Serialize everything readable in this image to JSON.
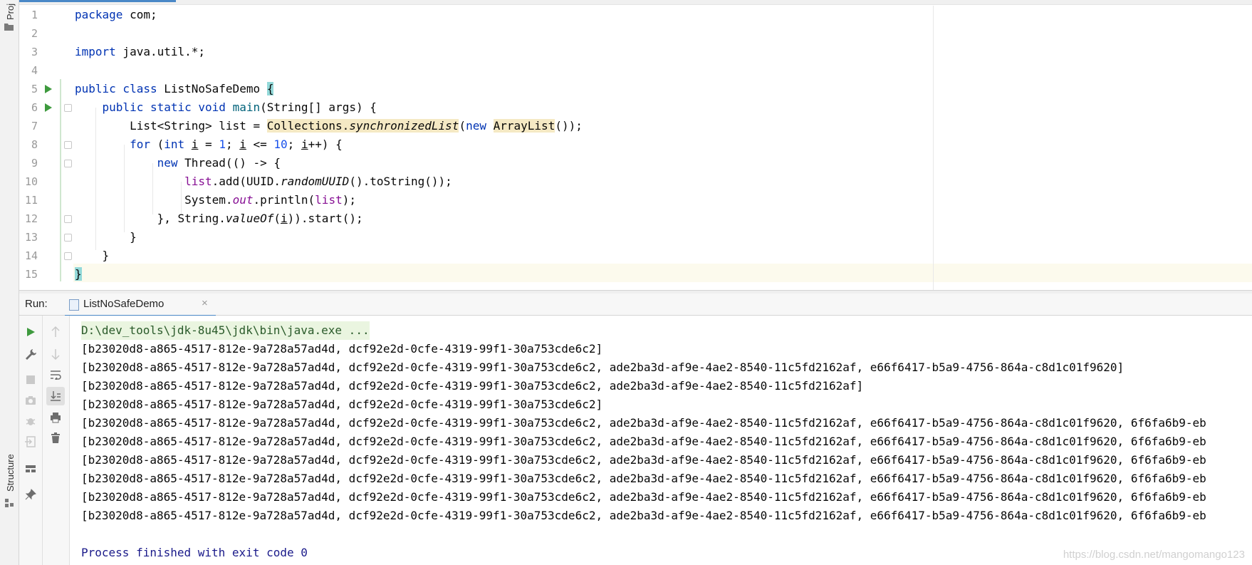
{
  "sidebar": {
    "project_label": "Proj",
    "structure_label": "Structure"
  },
  "editor": {
    "line_numbers": [
      "1",
      "2",
      "3",
      "4",
      "5",
      "6",
      "7",
      "8",
      "9",
      "10",
      "11",
      "12",
      "13",
      "14",
      "15"
    ]
  },
  "run_panel": {
    "run_label": "Run:",
    "tab_label": "ListNoSafeDemo",
    "command": "D:\\dev_tools\\jdk-8u45\\jdk\\bin\\java.exe ...",
    "output_lines": [
      "[b23020d8-a865-4517-812e-9a728a57ad4d, dcf92e2d-0cfe-4319-99f1-30a753cde6c2]",
      "[b23020d8-a865-4517-812e-9a728a57ad4d, dcf92e2d-0cfe-4319-99f1-30a753cde6c2, ade2ba3d-af9e-4ae2-8540-11c5fd2162af, e66f6417-b5a9-4756-864a-c8d1c01f9620]",
      "[b23020d8-a865-4517-812e-9a728a57ad4d, dcf92e2d-0cfe-4319-99f1-30a753cde6c2, ade2ba3d-af9e-4ae2-8540-11c5fd2162af]",
      "[b23020d8-a865-4517-812e-9a728a57ad4d, dcf92e2d-0cfe-4319-99f1-30a753cde6c2]",
      "[b23020d8-a865-4517-812e-9a728a57ad4d, dcf92e2d-0cfe-4319-99f1-30a753cde6c2, ade2ba3d-af9e-4ae2-8540-11c5fd2162af, e66f6417-b5a9-4756-864a-c8d1c01f9620, 6f6fa6b9-eb",
      "[b23020d8-a865-4517-812e-9a728a57ad4d, dcf92e2d-0cfe-4319-99f1-30a753cde6c2, ade2ba3d-af9e-4ae2-8540-11c5fd2162af, e66f6417-b5a9-4756-864a-c8d1c01f9620, 6f6fa6b9-eb",
      "[b23020d8-a865-4517-812e-9a728a57ad4d, dcf92e2d-0cfe-4319-99f1-30a753cde6c2, ade2ba3d-af9e-4ae2-8540-11c5fd2162af, e66f6417-b5a9-4756-864a-c8d1c01f9620, 6f6fa6b9-eb",
      "[b23020d8-a865-4517-812e-9a728a57ad4d, dcf92e2d-0cfe-4319-99f1-30a753cde6c2, ade2ba3d-af9e-4ae2-8540-11c5fd2162af, e66f6417-b5a9-4756-864a-c8d1c01f9620, 6f6fa6b9-eb",
      "[b23020d8-a865-4517-812e-9a728a57ad4d, dcf92e2d-0cfe-4319-99f1-30a753cde6c2, ade2ba3d-af9e-4ae2-8540-11c5fd2162af, e66f6417-b5a9-4756-864a-c8d1c01f9620, 6f6fa6b9-eb",
      "[b23020d8-a865-4517-812e-9a728a57ad4d, dcf92e2d-0cfe-4319-99f1-30a753cde6c2, ade2ba3d-af9e-4ae2-8540-11c5fd2162af, e66f6417-b5a9-4756-864a-c8d1c01f9620, 6f6fa6b9-eb"
    ],
    "finished": "Process finished with exit code 0"
  },
  "watermark": "https://blog.csdn.net/mangomango123",
  "icons": {
    "run": "run-icon",
    "wrench": "wrench-icon",
    "stop": "stop-icon",
    "camera": "camera-icon",
    "bug": "debug-icon",
    "exit": "exit-icon",
    "layout": "layout-icon",
    "pin": "pin-icon",
    "up": "arrow-up-icon",
    "down": "arrow-down-icon",
    "soft_wrap": "soft-wrap-icon",
    "scroll_end": "scroll-to-end-icon",
    "print": "print-icon",
    "trash": "trash-icon"
  }
}
